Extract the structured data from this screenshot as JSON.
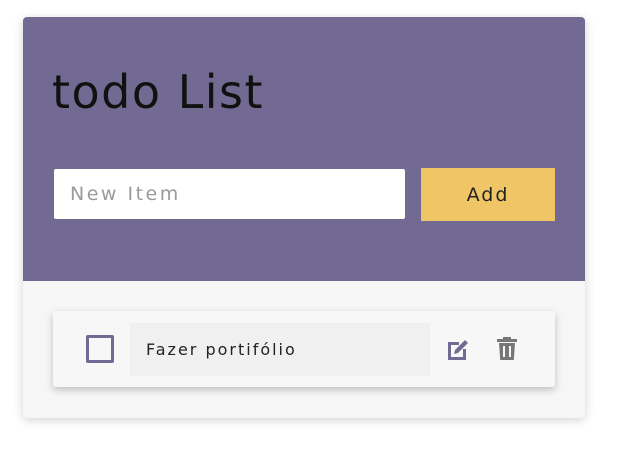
{
  "app": {
    "title": "todo List"
  },
  "form": {
    "input_placeholder": "New Item",
    "input_value": "",
    "add_label": "Add"
  },
  "todos": [
    {
      "text": "Fazer portifólio",
      "done": false
    }
  ],
  "colors": {
    "header": "#726a93",
    "accent": "#f0c566",
    "checkbox": "#726a93",
    "edit_icon": "#726a93",
    "trash_icon": "#777777"
  },
  "icons": {
    "edit": "pencil-square-icon",
    "delete": "trash-icon"
  }
}
